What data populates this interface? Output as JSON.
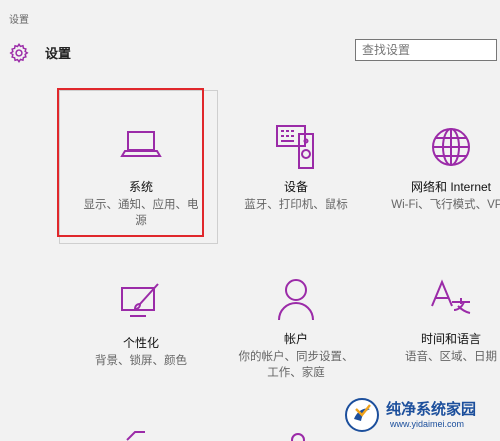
{
  "window": {
    "title": "设置"
  },
  "header": {
    "title": "设置",
    "icon": "gear-icon"
  },
  "search": {
    "placeholder": "查找设置"
  },
  "tiles": [
    {
      "name": "系统",
      "desc": "显示、通知、应用、电源",
      "icon": "laptop-icon"
    },
    {
      "name": "设备",
      "desc": "蓝牙、打印机、鼠标",
      "icon": "devices-icon"
    },
    {
      "name": "网络和 Internet",
      "desc": "Wi-Fi、飞行模式、VPN",
      "icon": "globe-icon"
    },
    {
      "name": "个性化",
      "desc": "背景、锁屏、颜色",
      "icon": "personalization-icon"
    },
    {
      "name": "帐户",
      "desc": "你的帐户、同步设置、工作、家庭",
      "icon": "person-icon"
    },
    {
      "name": "时间和语言",
      "desc": "语音、区域、日期",
      "icon": "time-language-icon"
    }
  ],
  "watermark": {
    "title": "纯净系统家园",
    "url": "www.yidaimei.com"
  },
  "colors": {
    "accent": "#9b2ba8",
    "highlight": "#e0272b",
    "background": "#f2f2f2"
  }
}
